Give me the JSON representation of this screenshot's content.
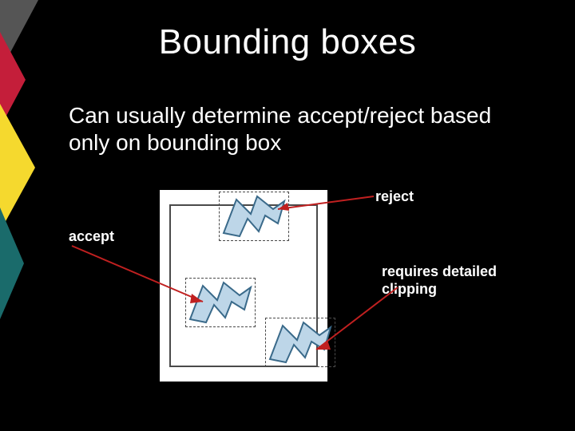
{
  "title": "Bounding boxes",
  "body": "Can usually determine accept/reject based only on bounding box",
  "labels": {
    "reject": "reject",
    "accept": "accept",
    "detailed": "requires detailed clipping"
  },
  "colors": {
    "red": "#f5d92e",
    "yellow": "#f5d92e",
    "teal": "#1a6b6b",
    "shape_fill": "#bdd6e8",
    "shape_stroke": "#3a6a8a",
    "arrow": "#c02020"
  }
}
